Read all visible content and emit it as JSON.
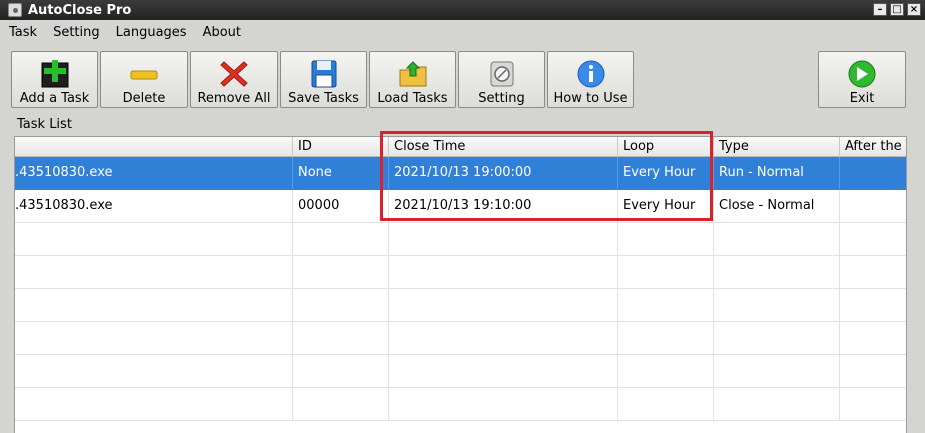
{
  "window": {
    "title": "AutoClose Pro"
  },
  "menu": [
    "Task",
    "Setting",
    "Languages",
    "About"
  ],
  "toolbar": {
    "add_task": "Add a Task",
    "delete": "Delete",
    "remove_all": "Remove All",
    "save_tasks": "Save Tasks",
    "load_tasks": "Load Tasks",
    "setting": "Setting",
    "how_to_use": "How to Use",
    "exit": "Exit"
  },
  "task_list": {
    "label": "Task List",
    "columns": [
      "",
      "ID",
      "Close Time",
      "Loop",
      "Type",
      "After the T"
    ],
    "rows": [
      {
        "name": ".43510830.exe",
        "id": "None",
        "close_time": "2021/10/13 19:00:00",
        "loop": "Every Hour",
        "type": "Run - Normal",
        "after": "",
        "selected": true
      },
      {
        "name": ".43510830.exe",
        "id": "00000",
        "close_time": "2021/10/13 19:10:00",
        "loop": "Every Hour",
        "type": "Close - Normal",
        "after": "",
        "selected": false
      }
    ]
  },
  "colors": {
    "selection": "#3080d8",
    "highlight_box": "#d6232d"
  }
}
